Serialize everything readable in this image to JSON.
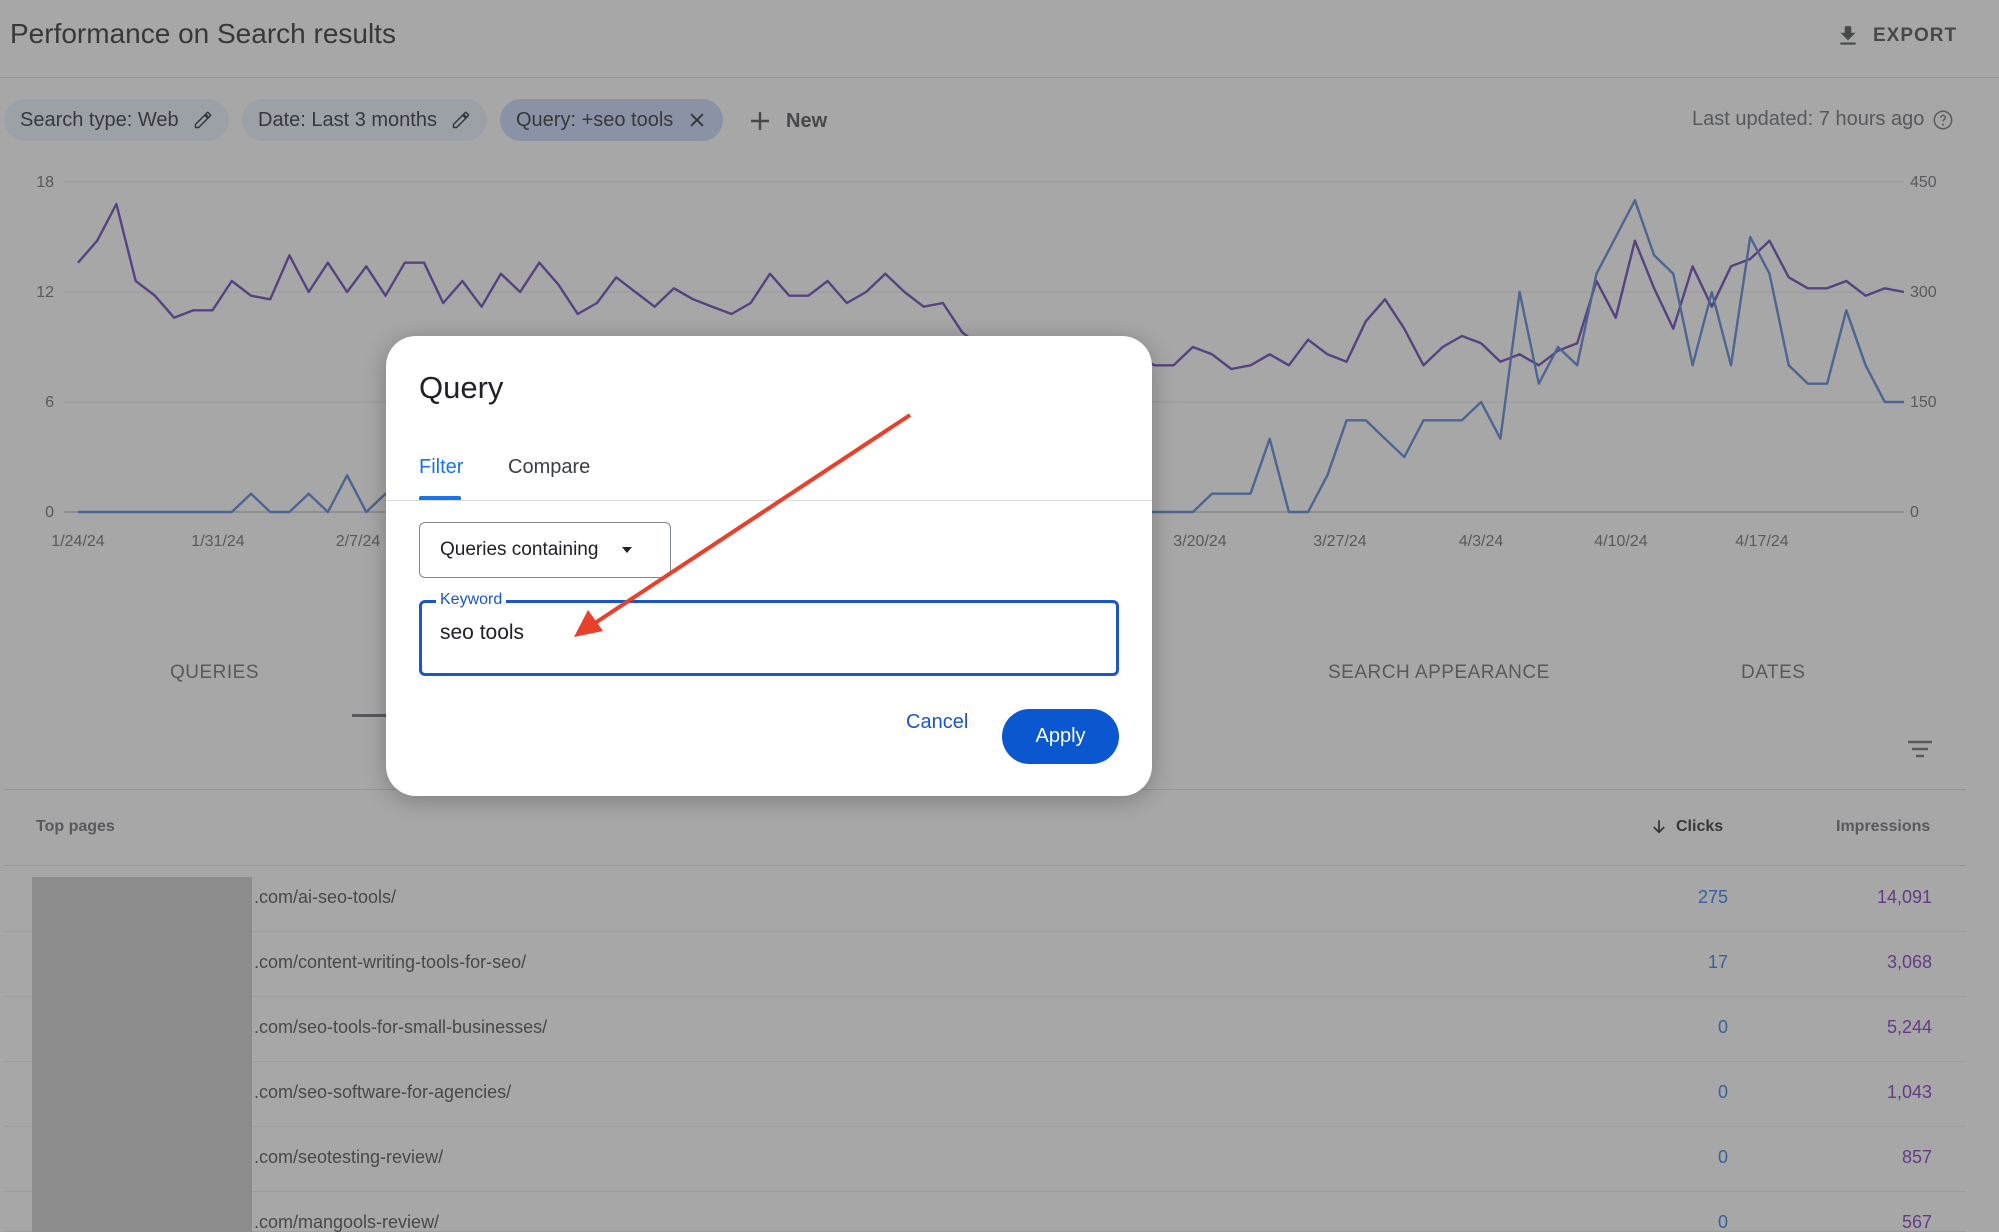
{
  "header": {
    "title": "Performance on Search results",
    "export_label": "EXPORT"
  },
  "filters": {
    "chips": [
      {
        "label": "Search type: Web",
        "icon": "edit-icon"
      },
      {
        "label": "Date: Last 3 months",
        "icon": "edit-icon"
      },
      {
        "label": "Query: +seo tools",
        "icon": "close-icon"
      }
    ],
    "new_label": "New",
    "last_updated": "Last updated: 7 hours ago"
  },
  "chart_data": {
    "type": "line",
    "x_tick_labels": [
      "1/24/24",
      "1/31/24",
      "2/7/24",
      "3/20/24",
      "3/27/24",
      "4/3/24",
      "4/10/24",
      "4/17/24"
    ],
    "y_left_ticks": [
      0,
      6,
      12,
      18
    ],
    "y_right_ticks": [
      0,
      150,
      300,
      450
    ],
    "ylim_left": [
      0,
      18
    ],
    "ylim_right": [
      0,
      450
    ],
    "series": [
      {
        "axis": "right",
        "color": "#5e35b1",
        "values": [
          340,
          370,
          420,
          315,
          295,
          265,
          275,
          275,
          315,
          295,
          290,
          350,
          300,
          340,
          300,
          335,
          295,
          340,
          340,
          285,
          315,
          280,
          325,
          300,
          340,
          310,
          270,
          285,
          320,
          300,
          280,
          305,
          290,
          280,
          270,
          285,
          325,
          295,
          295,
          315,
          285,
          300,
          325,
          300,
          280,
          285,
          245,
          225,
          200,
          180,
          230,
          200,
          190,
          205,
          195,
          215,
          200,
          200,
          225,
          215,
          195,
          200,
          215,
          200,
          235,
          215,
          205,
          260,
          290,
          250,
          200,
          225,
          240,
          230,
          205,
          215,
          200,
          220,
          230,
          315,
          265,
          370,
          305,
          250,
          335,
          280,
          335,
          345,
          370,
          320,
          305,
          305,
          315,
          295,
          305,
          300
        ]
      },
      {
        "axis": "left",
        "color": "#4a7bd0",
        "values": [
          0,
          0,
          0,
          0,
          0,
          0,
          0,
          0,
          0,
          1,
          0,
          0,
          1,
          0,
          2,
          0,
          1,
          1,
          0,
          2,
          0,
          1,
          1,
          1,
          0,
          0,
          0,
          0,
          1,
          0,
          0,
          0,
          0,
          1,
          0,
          0,
          0,
          0,
          0,
          0,
          0,
          0,
          1,
          0,
          0,
          0,
          0,
          0,
          0,
          0,
          0,
          1,
          1,
          0,
          0,
          0,
          0,
          0,
          0,
          1,
          1,
          1,
          4,
          0,
          0,
          2,
          5,
          5,
          4,
          3,
          5,
          5,
          5,
          6,
          4,
          12,
          7,
          9,
          8,
          13,
          15,
          17,
          14,
          13,
          8,
          12,
          8,
          15,
          13,
          8,
          7,
          7,
          11,
          8,
          6,
          6
        ]
      }
    ]
  },
  "tabs": {
    "queries": "QUERIES",
    "search_appearance": "SEARCH APPEARANCE",
    "dates": "DATES"
  },
  "table": {
    "col_pages": "Top pages",
    "col_clicks": "Clicks",
    "col_impressions": "Impressions",
    "rows": [
      {
        "url": ".com/ai-seo-tools/",
        "clicks": "275",
        "impressions": "14,091"
      },
      {
        "url": ".com/content-writing-tools-for-seo/",
        "clicks": "17",
        "impressions": "3,068"
      },
      {
        "url": ".com/seo-tools-for-small-businesses/",
        "clicks": "0",
        "impressions": "5,244"
      },
      {
        "url": ".com/seo-software-for-agencies/",
        "clicks": "0",
        "impressions": "1,043"
      },
      {
        "url": ".com/seotesting-review/",
        "clicks": "0",
        "impressions": "857"
      },
      {
        "url": ".com/mangools-review/",
        "clicks": "0",
        "impressions": "567"
      }
    ]
  },
  "dialog": {
    "title": "Query",
    "tab_filter": "Filter",
    "tab_compare": "Compare",
    "dropdown_value": "Queries containing",
    "keyword_label": "Keyword",
    "keyword_value": "seo tools",
    "cancel_label": "Cancel",
    "apply_label": "Apply"
  },
  "colors": {
    "accent": "#1a73e8",
    "primary_button": "#0b57d0",
    "annotation_arrow": "#e8402a"
  }
}
